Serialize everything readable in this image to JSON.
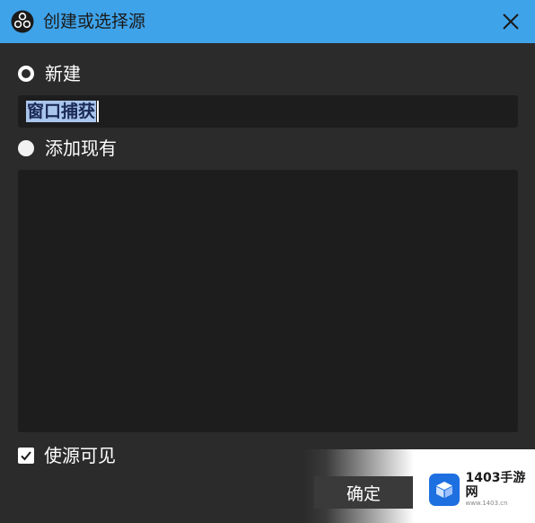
{
  "window": {
    "title": "创建或选择源",
    "accent": "#3fa3ea",
    "background": "#2b2b2b"
  },
  "options": {
    "new_label": "新建",
    "new_selected": true,
    "name_value": "窗口捕获",
    "existing_label": "添加现有",
    "existing_selected": false
  },
  "existing_list": {
    "items": []
  },
  "visibility": {
    "label": "使源可见",
    "checked": true
  },
  "footer": {
    "ok_label": "确定"
  },
  "watermark": {
    "name": "1403手游网",
    "url": "www.1403.cn"
  }
}
